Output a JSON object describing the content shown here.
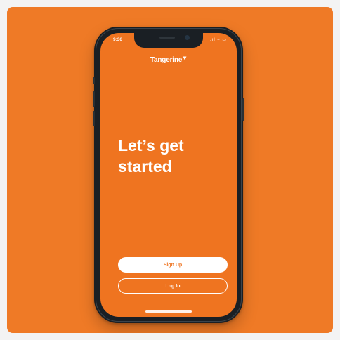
{
  "status_bar": {
    "time": "9:36",
    "icons": ".ıl ≈ ▭"
  },
  "app": {
    "logo_text": "Tangerine"
  },
  "main": {
    "headline_line1": "Let’s get",
    "headline_line2": "started"
  },
  "actions": {
    "signup_label": "Sign Up",
    "login_label": "Log In"
  },
  "colors": {
    "background": "#ef7a26",
    "screen": "#ef7420",
    "button_primary_bg": "#ffffff",
    "button_text_primary": "#ef7420"
  },
  "icons": {
    "camera": "front-camera-icon",
    "speaker": "speaker-grille-icon"
  }
}
